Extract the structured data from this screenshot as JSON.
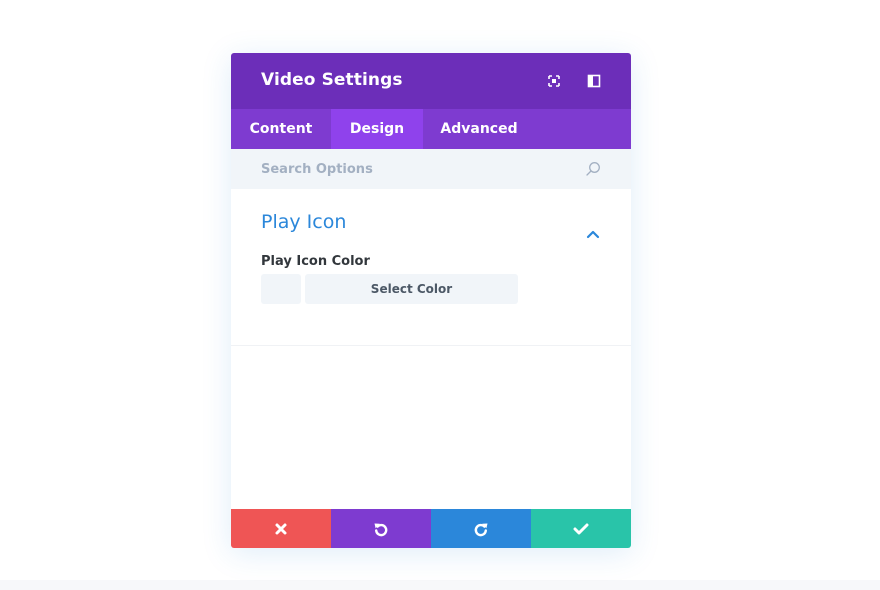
{
  "modal": {
    "title": "Video Settings",
    "icons": {
      "expand": "expand-icon",
      "sidebar": "sidebar-toggle-icon"
    }
  },
  "tabs": [
    {
      "label": "Content",
      "active": false
    },
    {
      "label": "Design",
      "active": true
    },
    {
      "label": "Advanced",
      "active": false
    }
  ],
  "search": {
    "placeholder": "Search Options",
    "value": ""
  },
  "section": {
    "title": "Play Icon",
    "expanded": true,
    "field_label": "Play Icon Color",
    "select_color_label": "Select Color"
  },
  "footer": {
    "buttons": [
      "close-icon",
      "undo-icon",
      "redo-icon",
      "check-icon"
    ]
  },
  "colors": {
    "header": "#6c2eb9",
    "tabs": "#7e3bd0",
    "active_tab": "#8f42ec",
    "accent_blue": "#2b87da",
    "close": "#ef5555",
    "undo": "#7e3bd0",
    "redo": "#2b87da",
    "save": "#29c4a9"
  }
}
